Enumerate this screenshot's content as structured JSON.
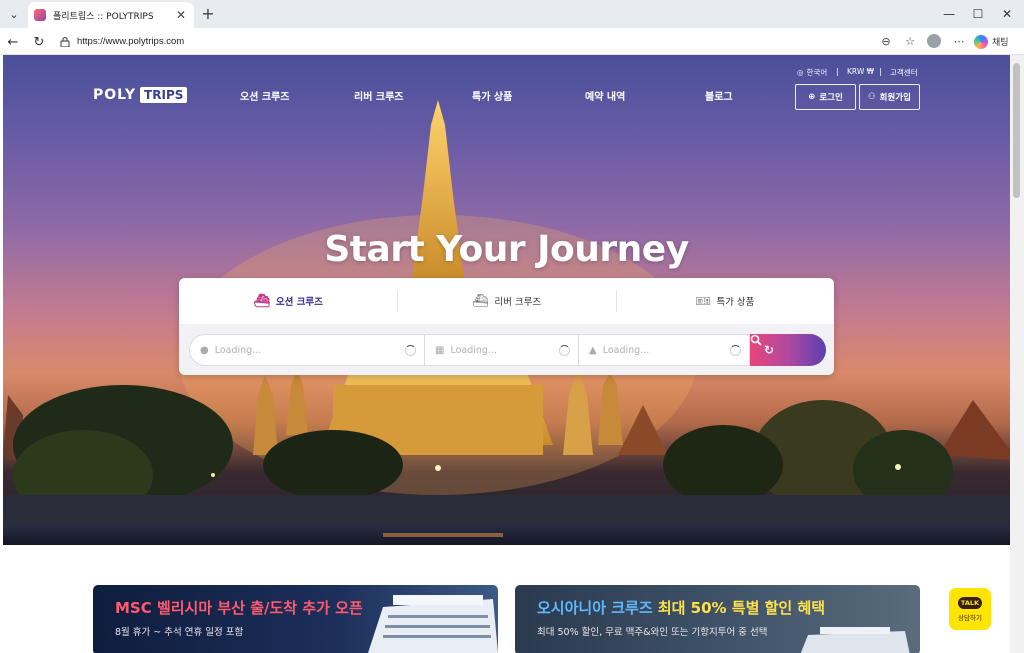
{
  "browser": {
    "tab_title": "폴리트립스 :: POLYTRIPS",
    "url": "https://www.polytrips.com",
    "copilot_label": "채팅"
  },
  "site": {
    "logo_poly": "POLY",
    "logo_trips": "TRIPS",
    "nav": [
      "오션 크루즈",
      "리버 크루즈",
      "특가 상품",
      "예약 내역",
      "블로그"
    ],
    "util": {
      "language": "한국어",
      "currency": "KRW ₩",
      "support": "고객센터"
    },
    "login_label": "로그인",
    "signup_label": "회원가입",
    "headline": "Start Your Journey"
  },
  "search": {
    "tabs": [
      "오션 크루즈",
      "리버 크루즈",
      "특가 상품"
    ],
    "active_tab": "오션 크루즈",
    "fields": [
      {
        "placeholder": "Loading...",
        "icon": "location-pin-icon"
      },
      {
        "placeholder": "Loading...",
        "icon": "calendar-icon"
      },
      {
        "placeholder": "Loading...",
        "icon": "ship-icon"
      }
    ]
  },
  "banners": [
    {
      "title_highlight": "MSC 벨리시마",
      "title_rest": " 부산 출/도착 추가 오픈",
      "subtitle": "8월 휴가 ~ 추석 연휴 일정 포함",
      "highlight_color": "#ff5a6e"
    },
    {
      "title_highlight": "오시아니아 크루즈",
      "title_rest": " 최대 50% 특별 할인 혜택",
      "subtitle": "최대 50% 할인, 무료 맥주&와인 또는 기항지투어 중 선택",
      "highlight_color": "#5fb8ff",
      "rest_color": "#ffe14d"
    }
  ],
  "kakao": {
    "badge": "TALK",
    "label": "상담하기"
  }
}
